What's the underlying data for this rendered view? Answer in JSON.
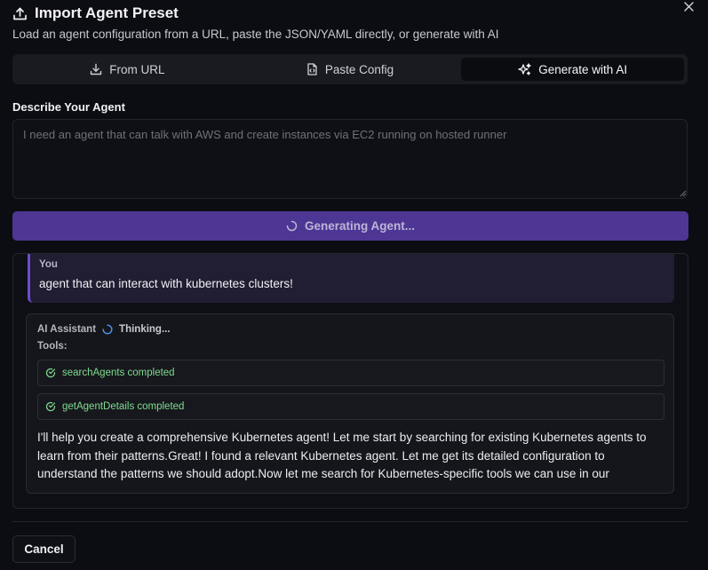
{
  "dialog": {
    "title": "Import Agent Preset",
    "subtitle": "Load an agent configuration from a URL, paste the JSON/YAML directly, or generate with AI",
    "close_icon": "close-icon",
    "title_icon": "upload-icon"
  },
  "tabs": [
    {
      "label": "From URL",
      "icon": "download-icon",
      "active": false
    },
    {
      "label": "Paste Config",
      "icon": "file-code-icon",
      "active": false
    },
    {
      "label": "Generate with AI",
      "icon": "sparkles-icon",
      "active": true
    }
  ],
  "describe": {
    "label": "Describe Your Agent",
    "placeholder": "I need an agent that can talk with AWS and create instances via EC2 running on hosted runner",
    "value": ""
  },
  "generate_button": {
    "label": "Generating Agent...",
    "icon": "spinner-icon",
    "color": "#4e3694"
  },
  "chat": {
    "user": {
      "role": "You",
      "text": "agent that can interact with kubernetes clusters!"
    },
    "assistant": {
      "role": "AI Assistant",
      "status": "Thinking...",
      "tools_label": "Tools:",
      "tools": [
        {
          "label": "searchAgents completed",
          "icon": "check-circle-icon"
        },
        {
          "label": "getAgentDetails completed",
          "icon": "check-circle-icon"
        }
      ],
      "text": "I'll help you create a comprehensive Kubernetes agent! Let me start by searching for existing Kubernetes agents to learn from their patterns.Great! I found a relevant Kubernetes agent. Let me get its detailed configuration to understand the patterns we should adopt.Now let me search for Kubernetes-specific tools we can use in our"
    }
  },
  "footer": {
    "cancel_label": "Cancel"
  },
  "colors": {
    "accent": "#6e4bd2",
    "success": "#7fdc8f",
    "background": "#0c0d12"
  }
}
